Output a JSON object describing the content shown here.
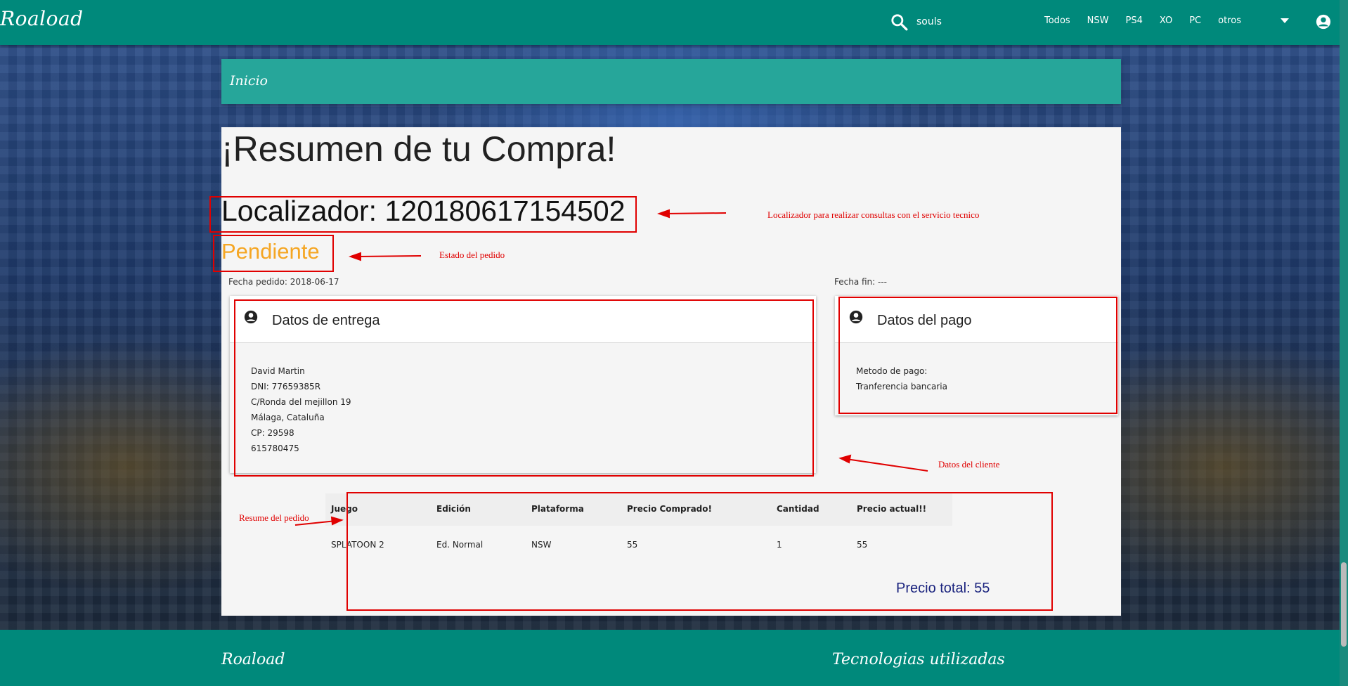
{
  "navbar": {
    "brand": "Roaload",
    "search_value": "souls",
    "links": [
      "Todos",
      "NSW",
      "PS4",
      "XO",
      "PC",
      "otros"
    ]
  },
  "breadcrumb": "Inicio",
  "summary": {
    "title": "¡Resumen de tu Compra!",
    "locator_label": "Localizador: 120180617154502",
    "status": "Pendiente",
    "fecha_pedido": "Fecha pedido: 2018-06-17",
    "fecha_fin": "Fecha fin: ---"
  },
  "entrega": {
    "title": "Datos de entrega",
    "lines": [
      "David Martin",
      "DNI: 77659385R",
      "C/Ronda del mejillon 19",
      "Málaga, Cataluña",
      "CP: 29598",
      "615780475"
    ]
  },
  "pago": {
    "title": "Datos del pago",
    "lines": [
      "Metodo de pago:",
      "Tranferencia bancaria"
    ]
  },
  "order": {
    "headers": [
      "Juego",
      "Edición",
      "Plataforma",
      "Precio Comprado!",
      "Cantidad",
      "Precio actual!!"
    ],
    "rows": [
      [
        "SPLATOON 2",
        "Ed. Normal",
        "NSW",
        "55",
        "1",
        "55"
      ]
    ],
    "total": "Precio total: 55"
  },
  "annotations": {
    "localizador": "Localizador para realizar consultas con el servicio tecnico",
    "estado": "Estado del pedido",
    "cliente": "Datos del cliente",
    "resumen": "Resume del pedido"
  },
  "footer": {
    "left": "Roaload",
    "right": "Tecnologias utilizadas"
  },
  "colors": {
    "navbar": "#00897b",
    "breadcrumb": "#26a69a",
    "status": "#f5a623",
    "annotation": "#e00000",
    "total": "#1a237e"
  }
}
